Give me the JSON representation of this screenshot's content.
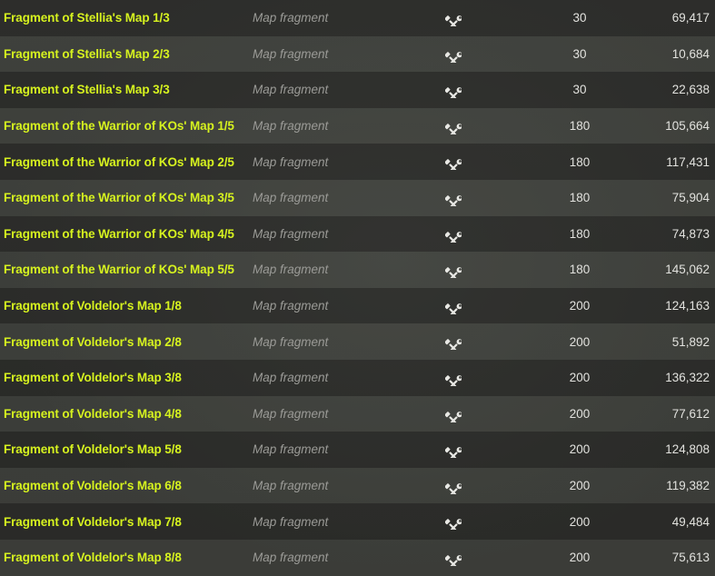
{
  "rows": [
    {
      "name": "Fragment of Stellia's Map 1/3",
      "type": "Map fragment",
      "icon": "tools-icon",
      "weight": "30",
      "price": "69,417"
    },
    {
      "name": "Fragment of Stellia's Map 2/3",
      "type": "Map fragment",
      "icon": "tools-icon",
      "weight": "30",
      "price": "10,684"
    },
    {
      "name": "Fragment of Stellia's Map 3/3",
      "type": "Map fragment",
      "icon": "tools-icon",
      "weight": "30",
      "price": "22,638"
    },
    {
      "name": "Fragment of the Warrior of KOs' Map 1/5",
      "type": "Map fragment",
      "icon": "tools-icon",
      "weight": "180",
      "price": "105,664"
    },
    {
      "name": "Fragment of the Warrior of KOs' Map 2/5",
      "type": "Map fragment",
      "icon": "tools-icon",
      "weight": "180",
      "price": "117,431"
    },
    {
      "name": "Fragment of the Warrior of KOs' Map 3/5",
      "type": "Map fragment",
      "icon": "tools-icon",
      "weight": "180",
      "price": "75,904"
    },
    {
      "name": "Fragment of the Warrior of KOs' Map 4/5",
      "type": "Map fragment",
      "icon": "tools-icon",
      "weight": "180",
      "price": "74,873"
    },
    {
      "name": "Fragment of the Warrior of KOs' Map 5/5",
      "type": "Map fragment",
      "icon": "tools-icon",
      "weight": "180",
      "price": "145,062"
    },
    {
      "name": "Fragment of Voldelor's Map 1/8",
      "type": "Map fragment",
      "icon": "tools-icon",
      "weight": "200",
      "price": "124,163"
    },
    {
      "name": "Fragment of Voldelor's Map 2/8",
      "type": "Map fragment",
      "icon": "tools-icon",
      "weight": "200",
      "price": "51,892"
    },
    {
      "name": "Fragment of Voldelor's Map 3/8",
      "type": "Map fragment",
      "icon": "tools-icon",
      "weight": "200",
      "price": "136,322"
    },
    {
      "name": "Fragment of Voldelor's Map 4/8",
      "type": "Map fragment",
      "icon": "tools-icon",
      "weight": "200",
      "price": "77,612"
    },
    {
      "name": "Fragment of Voldelor's Map 5/8",
      "type": "Map fragment",
      "icon": "tools-icon",
      "weight": "200",
      "price": "124,808"
    },
    {
      "name": "Fragment of Voldelor's Map 6/8",
      "type": "Map fragment",
      "icon": "tools-icon",
      "weight": "200",
      "price": "119,382"
    },
    {
      "name": "Fragment of Voldelor's Map 7/8",
      "type": "Map fragment",
      "icon": "tools-icon",
      "weight": "200",
      "price": "49,484"
    },
    {
      "name": "Fragment of Voldelor's Map 8/8",
      "type": "Map fragment",
      "icon": "tools-icon",
      "weight": "200",
      "price": "75,613"
    }
  ],
  "colors": {
    "item_name": "#d6f21f",
    "item_type": "#9a9a96",
    "value_text": "#e2e2de"
  }
}
